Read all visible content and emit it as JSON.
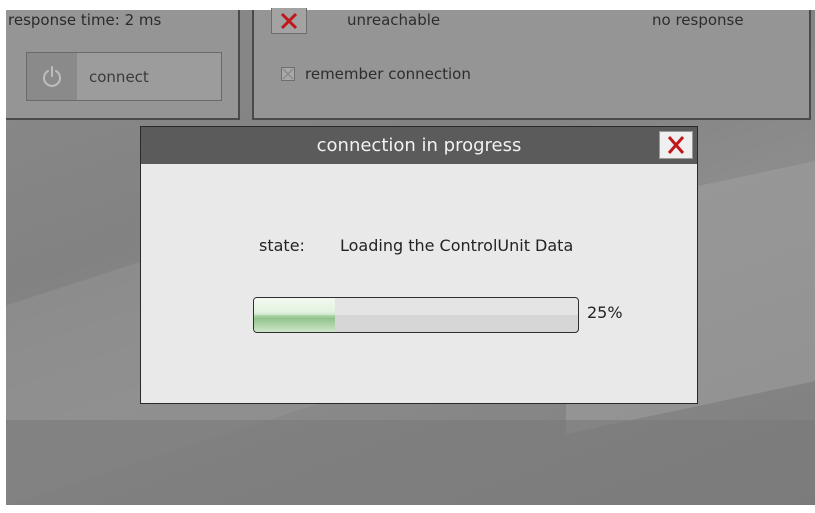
{
  "top_left_panel": {
    "response_time": "response time: 2 ms",
    "connect_label": "connect",
    "power_icon": "power-icon"
  },
  "top_right_panel": {
    "status_icon": "close-x-icon",
    "status_text": "unreachable",
    "response_text": "no response",
    "remember_label": "remember connection",
    "remember_checked": false
  },
  "dialog": {
    "title": "connection in progress",
    "close_icon": "close-x-icon",
    "state_label": "state:",
    "state_value": "Loading the ControlUnit Data",
    "progress_percent": 25,
    "progress_label": "25%"
  },
  "colors": {
    "close_red": "#c0171b",
    "progress_green": "#93c38d",
    "titlebar": "#5b5b5b"
  }
}
